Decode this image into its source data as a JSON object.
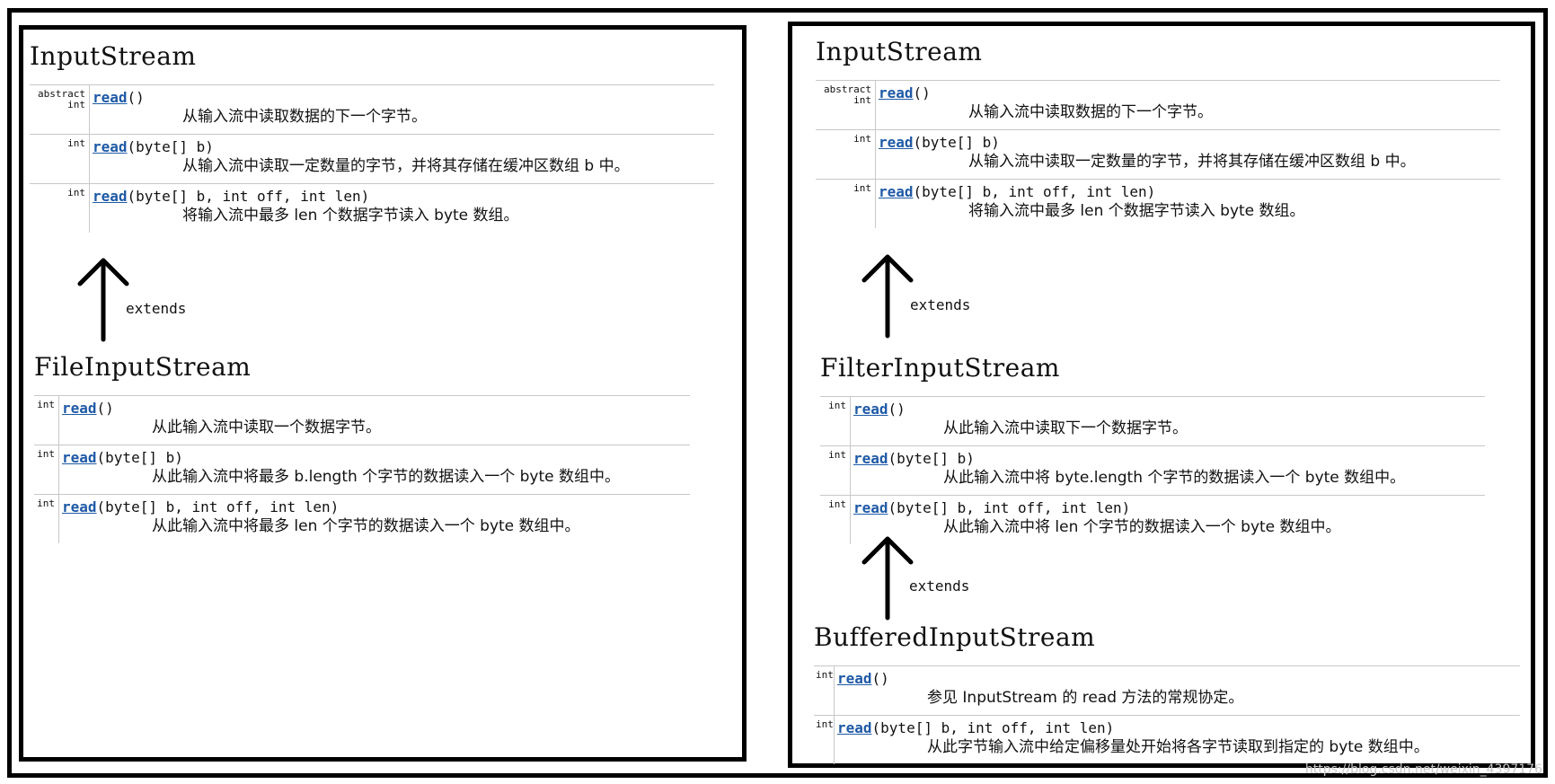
{
  "left_panel": {
    "input_stream": {
      "title": "InputStream",
      "methods": [
        {
          "modifier": "abstract int",
          "name": "read",
          "params": "()",
          "desc": "从输入流中读取数据的下一个字节。"
        },
        {
          "modifier": "int",
          "name": "read",
          "params": "(byte[] b)",
          "desc": "从输入流中读取一定数量的字节，并将其存储在缓冲区数组 b 中。"
        },
        {
          "modifier": "int",
          "name": "read",
          "params": "(byte[] b, int off, int len)",
          "desc": "将输入流中最多 len 个数据字节读入 byte 数组。"
        }
      ]
    },
    "extends_label": "extends",
    "file_input_stream": {
      "title": "FileInputStream",
      "methods": [
        {
          "modifier": "int",
          "name": "read",
          "params": "()",
          "desc": "从此输入流中读取一个数据字节。"
        },
        {
          "modifier": "int",
          "name": "read",
          "params": "(byte[] b)",
          "desc": "从此输入流中将最多 b.length 个字节的数据读入一个 byte 数组中。"
        },
        {
          "modifier": "int",
          "name": "read",
          "params": "(byte[] b, int off, int len)",
          "desc": "从此输入流中将最多 len 个字节的数据读入一个 byte 数组中。"
        }
      ]
    }
  },
  "right_panel": {
    "input_stream": {
      "title": "InputStream",
      "methods": [
        {
          "modifier": "abstract int",
          "name": "read",
          "params": "()",
          "desc": "从输入流中读取数据的下一个字节。"
        },
        {
          "modifier": "int",
          "name": "read",
          "params": "(byte[] b)",
          "desc": "从输入流中读取一定数量的字节，并将其存储在缓冲区数组 b 中。"
        },
        {
          "modifier": "int",
          "name": "read",
          "params": "(byte[] b, int off, int len)",
          "desc": "将输入流中最多 len 个数据字节读入 byte 数组。"
        }
      ]
    },
    "extends_label_1": "extends",
    "filter_input_stream": {
      "title": "FilterInputStream",
      "methods": [
        {
          "modifier": "int",
          "name": "read",
          "params": "()",
          "desc": "从此输入流中读取下一个数据字节。"
        },
        {
          "modifier": "int",
          "name": "read",
          "params": "(byte[] b)",
          "desc": "从此输入流中将 byte.length 个字节的数据读入一个 byte 数组中。"
        },
        {
          "modifier": "int",
          "name": "read",
          "params": "(byte[] b, int off, int len)",
          "desc": "从此输入流中将 len 个字节的数据读入一个 byte 数组中。"
        }
      ]
    },
    "extends_label_2": "extends",
    "buffered_input_stream": {
      "title": "BufferedInputStream",
      "methods": [
        {
          "modifier": "int",
          "name": "read",
          "params": "()",
          "desc": "参见 InputStream 的 read 方法的常规协定。"
        },
        {
          "modifier": "int",
          "name": "read",
          "params": "(byte[] b, int off, int len)",
          "desc": "从此字节输入流中给定偏移量处开始将各字节读取到指定的 byte 数组中。"
        }
      ]
    }
  },
  "watermark": "https://blog.csdn.net/weixin_4397176"
}
